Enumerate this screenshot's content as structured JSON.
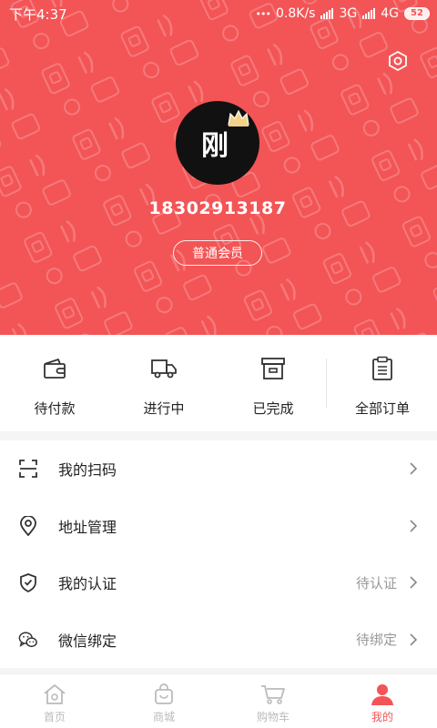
{
  "status_bar": {
    "time": "下午4:37",
    "dots": "•••",
    "network_speed": "0.8K/s",
    "network_3g": "3G",
    "network_4g": "4G",
    "battery": "52"
  },
  "profile": {
    "avatar_text": "刚",
    "phone": "18302913187",
    "member_level": "普通会员"
  },
  "orders": [
    {
      "label": "待付款",
      "icon": "wallet-icon"
    },
    {
      "label": "进行中",
      "icon": "truck-icon"
    },
    {
      "label": "已完成",
      "icon": "archive-box-icon"
    },
    {
      "label": "全部订单",
      "icon": "clipboard-icon"
    }
  ],
  "menu": [
    {
      "label": "我的扫码",
      "status": "",
      "icon": "scan-icon"
    },
    {
      "label": "地址管理",
      "status": "",
      "icon": "location-pin-icon"
    },
    {
      "label": "我的认证",
      "status": "待认证",
      "icon": "shield-check-icon"
    },
    {
      "label": "微信绑定",
      "status": "待绑定",
      "icon": "wechat-icon"
    }
  ],
  "tabs": [
    {
      "label": "首页",
      "icon": "home-icon",
      "active": false
    },
    {
      "label": "商城",
      "icon": "shopping-bag-icon",
      "active": false
    },
    {
      "label": "购物车",
      "icon": "cart-icon",
      "active": false
    },
    {
      "label": "我的",
      "icon": "user-icon",
      "active": true
    }
  ],
  "colors": {
    "brand_red": "#f35456",
    "inactive_gray": "#bbbbbb"
  }
}
